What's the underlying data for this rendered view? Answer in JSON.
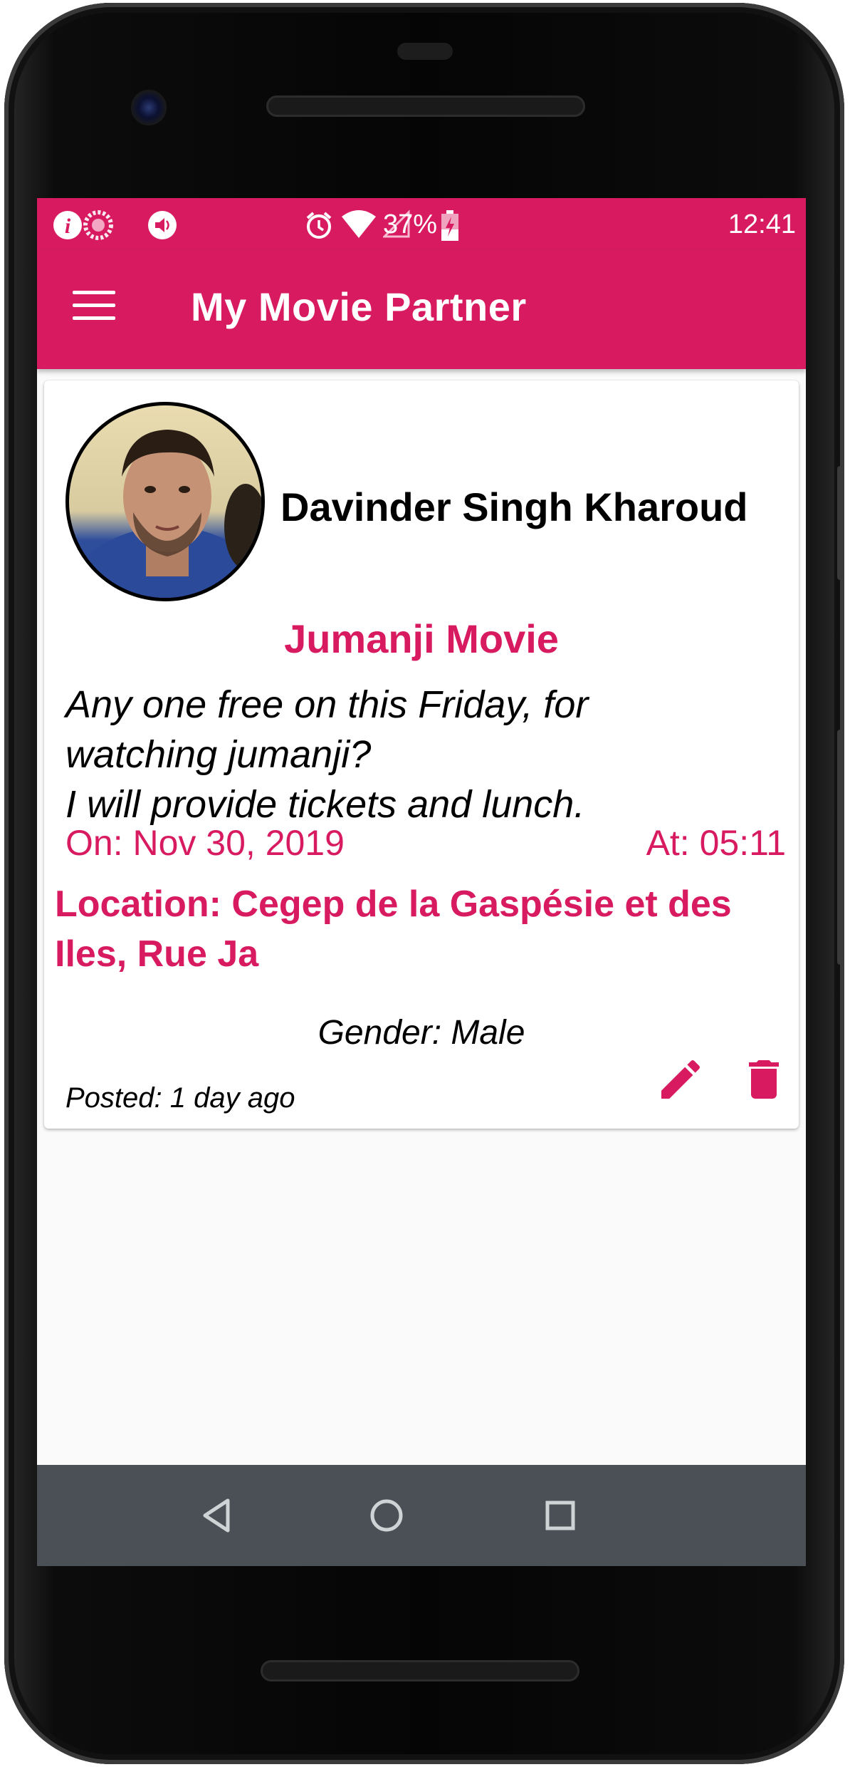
{
  "status_bar": {
    "battery": "37%",
    "time": "12:41"
  },
  "app_bar": {
    "title": "My Movie Partner"
  },
  "post": {
    "user_name": "Davinder Singh Kharoud",
    "title": "Jumanji Movie",
    "body_lines": [
      "Any one free on this Friday, for",
      "watching jumanji?",
      "I will provide tickets and lunch."
    ],
    "date": "On: Nov 30, 2019",
    "time": "At: 05:11",
    "location_lines": [
      "Location: Cegep de la Gaspésie et des",
      "Iles, Rue Ja"
    ],
    "gender": "Gender: Male",
    "posted": "Posted: 1 day ago"
  },
  "colors": {
    "accent": "#d81b60",
    "navbar": "#4a5056",
    "background": "#fafafa"
  },
  "icons": {
    "menu": "hamburger-menu-icon",
    "edit": "pencil-icon",
    "delete": "trash-icon",
    "back": "back-triangle-icon",
    "home": "home-circle-icon",
    "recents": "recents-square-icon"
  }
}
